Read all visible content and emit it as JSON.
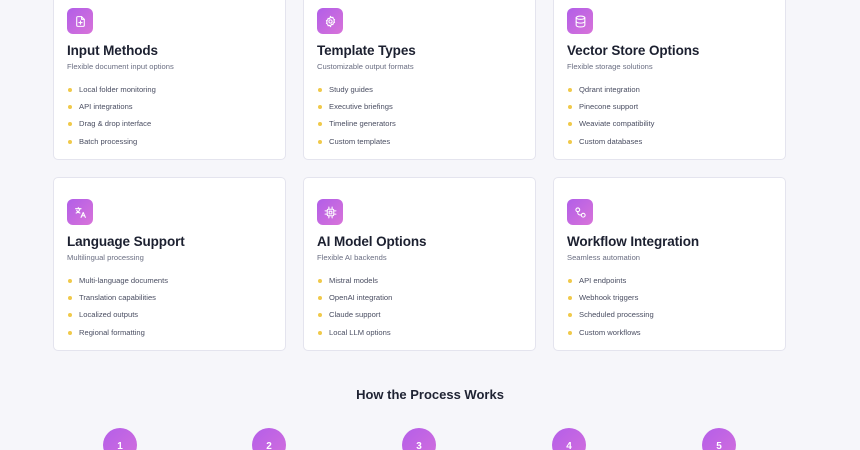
{
  "cards": [
    {
      "icon": "document-icon",
      "title": "Input Methods",
      "subtitle": "Flexible document input options",
      "items": [
        "Local folder monitoring",
        "API integrations",
        "Drag & drop interface",
        "Batch processing"
      ]
    },
    {
      "icon": "gear-icon",
      "title": "Template Types",
      "subtitle": "Customizable output formats",
      "items": [
        "Study guides",
        "Executive briefings",
        "Timeline generators",
        "Custom templates"
      ]
    },
    {
      "icon": "database-icon",
      "title": "Vector Store Options",
      "subtitle": "Flexible storage solutions",
      "items": [
        "Qdrant integration",
        "Pinecone support",
        "Weaviate compatibility",
        "Custom databases"
      ]
    },
    {
      "icon": "language-icon",
      "title": "Language Support",
      "subtitle": "Multilingual processing",
      "items": [
        "Multi-language documents",
        "Translation capabilities",
        "Localized outputs",
        "Regional formatting"
      ]
    },
    {
      "icon": "cpu-icon",
      "title": "AI Model Options",
      "subtitle": "Flexible AI backends",
      "items": [
        "Mistral models",
        "OpenAI integration",
        "Claude support",
        "Local LLM options"
      ]
    },
    {
      "icon": "workflow-icon",
      "title": "Workflow Integration",
      "subtitle": "Seamless automation",
      "items": [
        "API endpoints",
        "Webhook triggers",
        "Scheduled processing",
        "Custom workflows"
      ]
    }
  ],
  "process": {
    "title": "How the Process Works",
    "steps": [
      "1",
      "2",
      "3",
      "4",
      "5"
    ]
  },
  "colors": {
    "accent_start": "#b15ee8",
    "accent_end": "#d873d9",
    "bullet": "#f0c94a",
    "background": "#f6f6fa"
  }
}
